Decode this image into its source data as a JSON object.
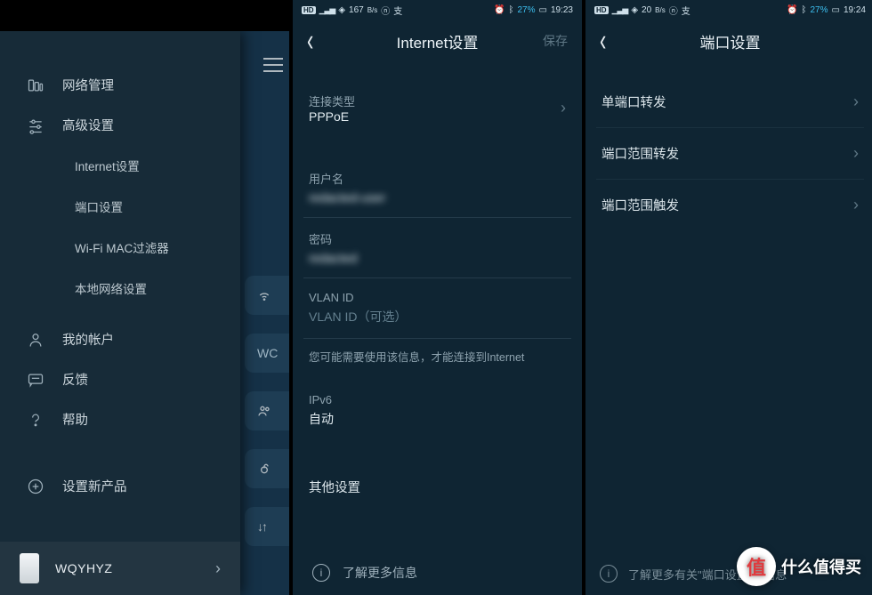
{
  "statusbar": {
    "hd": "HD",
    "net_speed1": "167",
    "net_speed_unit": "B/s",
    "net_speed2": "20",
    "battery": "27%",
    "time1": "19:23",
    "time2": "19:24"
  },
  "phone1": {
    "drawer": {
      "network_mgmt": "网络管理",
      "advanced": "高级设置",
      "sub_internet": "Internet设置",
      "sub_port": "端口设置",
      "sub_macfilter": "Wi-Fi MAC过滤器",
      "sub_localnet": "本地网络设置",
      "account": "我的帐户",
      "feedback": "反馈",
      "help": "帮助",
      "add_product": "设置新产品",
      "router_name": "WQYHYZ"
    },
    "behind_wifi_label": "WC"
  },
  "phone2": {
    "title": "Internet设置",
    "save": "保存",
    "conn_type_label": "连接类型",
    "conn_type_value": "PPPoE",
    "username_label": "用户名",
    "username_value": "redacted-user",
    "password_label": "密码",
    "password_value": "redacted",
    "vlan_label": "VLAN ID",
    "vlan_placeholder": "VLAN ID（可选）",
    "vlan_hint": "您可能需要使用该信息，才能连接到Internet",
    "ipv6_label": "IPv6",
    "ipv6_value": "自动",
    "other": "其他设置",
    "learn_more": "了解更多信息"
  },
  "phone3": {
    "title": "端口设置",
    "single_port": "单端口转发",
    "range_fwd": "端口范围转发",
    "range_trigger": "端口范围触发",
    "bottom_hint": "了解更多有关\"端口设置\"的信息"
  },
  "watermark": "什么值得买"
}
